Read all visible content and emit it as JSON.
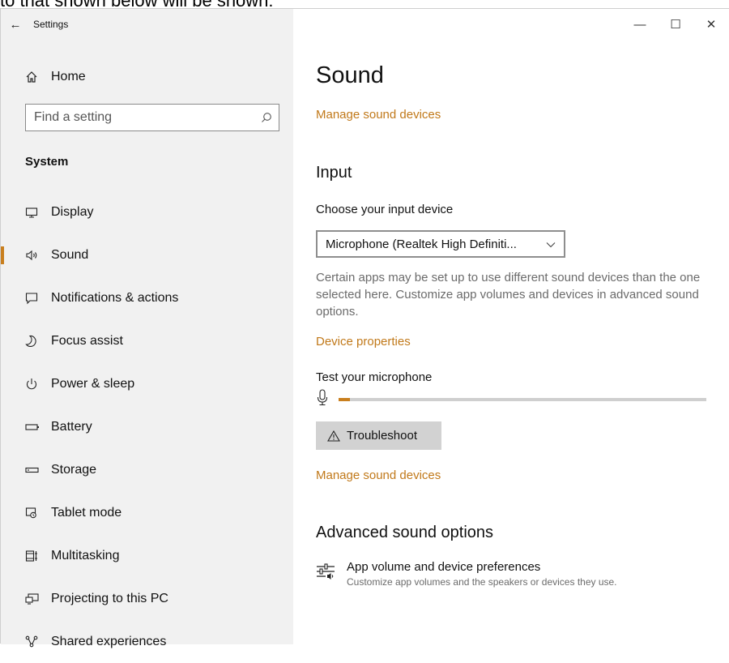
{
  "overlay": {
    "caption": "to that shown below will be shown:"
  },
  "window": {
    "back_glyph": "←",
    "title": "Settings",
    "minimize_glyph": "—",
    "maximize_glyph": "☐",
    "close_glyph": "✕"
  },
  "sidebar": {
    "home_label": "Home",
    "search_placeholder": "Find a setting",
    "section_label": "System",
    "active_accent": "#c97f1e",
    "items": [
      {
        "label": "Display",
        "icon": "monitor-icon"
      },
      {
        "label": "Sound",
        "icon": "speaker-icon",
        "active": true
      },
      {
        "label": "Notifications & actions",
        "icon": "notification-icon"
      },
      {
        "label": "Focus assist",
        "icon": "moon-icon"
      },
      {
        "label": "Power & sleep",
        "icon": "power-icon"
      },
      {
        "label": "Battery",
        "icon": "battery-icon"
      },
      {
        "label": "Storage",
        "icon": "storage-icon"
      },
      {
        "label": "Tablet mode",
        "icon": "tablet-mode-icon"
      },
      {
        "label": "Multitasking",
        "icon": "multitasking-icon"
      },
      {
        "label": "Projecting to this PC",
        "icon": "projecting-icon"
      },
      {
        "label": "Shared experiences",
        "icon": "shared-experiences-icon"
      }
    ]
  },
  "main": {
    "page_title": "Sound",
    "manage_devices_link_top": "Manage sound devices",
    "input_heading": "Input",
    "choose_input_label": "Choose your input device",
    "input_device_value": "Microphone (Realtek High Definiti...",
    "input_description": "Certain apps may be set up to use different sound devices than the one selected here. Customize app volumes and devices in advanced sound options.",
    "device_properties_link": "Device properties",
    "test_mic_label": "Test your microphone",
    "mic_level_fraction": 0.03,
    "troubleshoot_label": "Troubleshoot",
    "manage_devices_link_bottom": "Manage sound devices",
    "advanced_heading": "Advanced sound options",
    "app_volume_title": "App volume and device preferences",
    "app_volume_subtitle": "Customize app volumes and the speakers or devices they use.",
    "link_color": "#c1791a"
  }
}
